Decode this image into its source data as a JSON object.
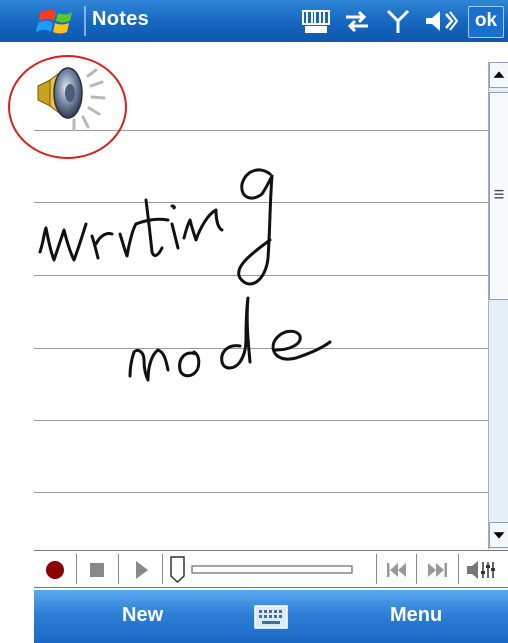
{
  "titlebar": {
    "title": "Notes",
    "ok_label": "ok"
  },
  "icons": {
    "start": "windows-flag-icon",
    "input": "input-panel-icon",
    "connectivity": "connectivity-icon",
    "signal": "signal-icon",
    "volume": "volume-icon",
    "recording": "speaker-recording-icon"
  },
  "note": {
    "handwriting": [
      "writing",
      "mode"
    ]
  },
  "recording_toolbar": {
    "buttons": [
      "record",
      "stop",
      "play",
      "rewind",
      "fast-forward",
      "volume"
    ],
    "playback_position": 0.0
  },
  "menubar": {
    "left_softkey": "New",
    "right_softkey": "Menu"
  },
  "colors": {
    "title_bar": "#1566bf",
    "command_bar": "#2d7fd7",
    "highlight_circle": "#d81e1e",
    "record_button": "#8b0000"
  }
}
